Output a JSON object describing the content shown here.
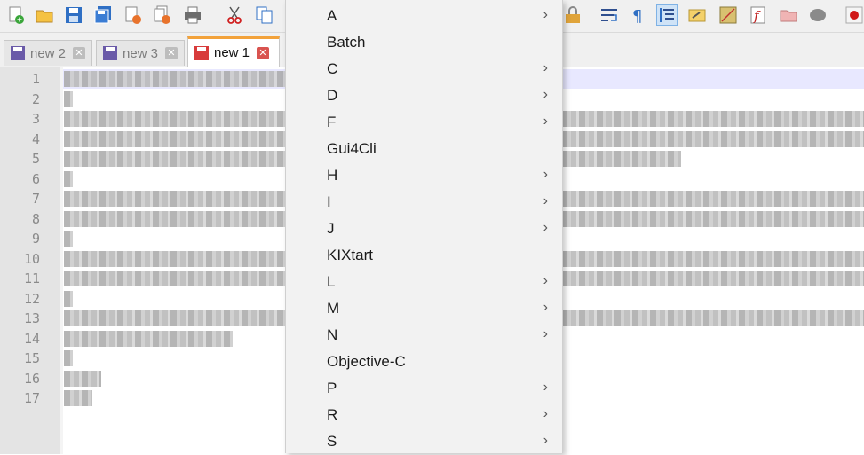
{
  "toolbar": {
    "icons": [
      "new-file-icon",
      "open-file-icon",
      "save-icon",
      "save-all-icon",
      "close-icon",
      "close-all-icon",
      "print-icon",
      "cut-icon",
      "copy-icon",
      "lock-icon",
      "word-wrap-icon",
      "show-all-chars-icon",
      "indent-guide-icon",
      "user-language-icon",
      "document-map-icon",
      "function-list-icon",
      "folder-workspace-icon",
      "monitoring-icon",
      "record-macro-icon"
    ]
  },
  "tabs": [
    {
      "label": "new 2",
      "close": "✕"
    },
    {
      "label": "new 3",
      "close": "✕"
    },
    {
      "label": "new 1",
      "close": "✕"
    }
  ],
  "editor": {
    "line_numbers": [
      "1",
      "2",
      "3",
      "4",
      "5",
      "6",
      "7",
      "8",
      "9",
      "10",
      "11",
      "12",
      "13",
      "14",
      "15",
      "16",
      "17"
    ]
  },
  "language_menu": {
    "items": [
      {
        "label": "A",
        "submenu": true
      },
      {
        "label": "Batch",
        "submenu": false
      },
      {
        "label": "C",
        "submenu": true
      },
      {
        "label": "D",
        "submenu": true
      },
      {
        "label": "F",
        "submenu": true
      },
      {
        "label": "Gui4Cli",
        "submenu": false
      },
      {
        "label": "H",
        "submenu": true
      },
      {
        "label": "I",
        "submenu": true
      },
      {
        "label": "J",
        "submenu": true
      },
      {
        "label": "KIXtart",
        "submenu": false
      },
      {
        "label": "L",
        "submenu": true
      },
      {
        "label": "M",
        "submenu": true
      },
      {
        "label": "N",
        "submenu": true
      },
      {
        "label": "Objective-C",
        "submenu": false
      },
      {
        "label": "P",
        "submenu": true
      },
      {
        "label": "R",
        "submenu": true
      },
      {
        "label": "S",
        "submenu": true
      }
    ],
    "arrow": "›"
  }
}
